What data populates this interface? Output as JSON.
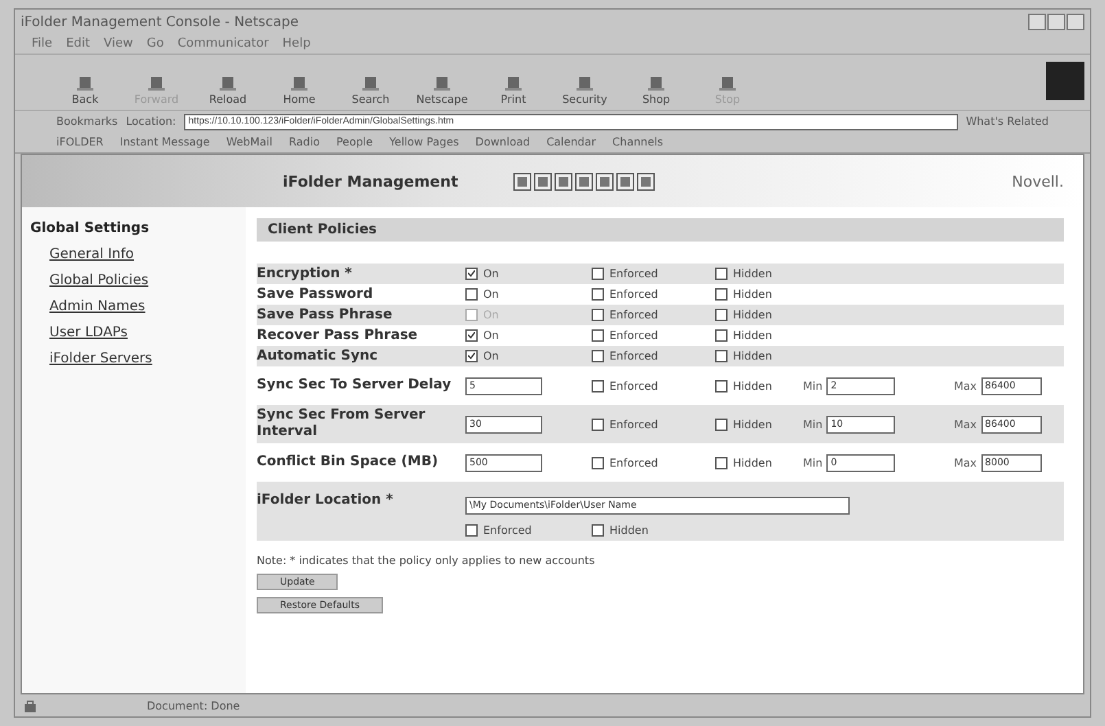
{
  "window": {
    "title": "iFolder Management Console - Netscape"
  },
  "menu": [
    "File",
    "Edit",
    "View",
    "Go",
    "Communicator",
    "Help"
  ],
  "toolbar": [
    {
      "label": "Back",
      "disabled": false
    },
    {
      "label": "Forward",
      "disabled": true
    },
    {
      "label": "Reload",
      "disabled": false
    },
    {
      "label": "Home",
      "disabled": false
    },
    {
      "label": "Search",
      "disabled": false
    },
    {
      "label": "Netscape",
      "disabled": false
    },
    {
      "label": "Print",
      "disabled": false
    },
    {
      "label": "Security",
      "disabled": false
    },
    {
      "label": "Shop",
      "disabled": false
    },
    {
      "label": "Stop",
      "disabled": true
    }
  ],
  "location_bar": {
    "bookmarks": "Bookmarks",
    "label": "Location:",
    "value": "https://10.10.100.123/iFolder/iFolderAdmin/GlobalSettings.htm",
    "related": "What's Related"
  },
  "personal_bar": [
    "iFOLDER",
    "Instant Message",
    "WebMail",
    "Radio",
    "People",
    "Yellow Pages",
    "Download",
    "Calendar",
    "Channels"
  ],
  "header": {
    "title": "iFolder Management",
    "brand": "Novell."
  },
  "sidebar": {
    "title": "Global Settings",
    "items": [
      {
        "label": "General Info"
      },
      {
        "label": "Global Policies"
      },
      {
        "label": "Admin Names"
      },
      {
        "label": "User LDAPs"
      },
      {
        "label": "iFolder Servers"
      }
    ]
  },
  "section": {
    "title": "Client Policies"
  },
  "policies": [
    {
      "kind": "toggle",
      "label": "Encryption *",
      "on": {
        "label": "On",
        "checked": true,
        "disabled": false
      },
      "enforced": {
        "label": "Enforced",
        "checked": false
      },
      "hidden": {
        "label": "Hidden",
        "checked": false
      }
    },
    {
      "kind": "toggle",
      "label": "Save Password",
      "on": {
        "label": "On",
        "checked": false,
        "disabled": false
      },
      "enforced": {
        "label": "Enforced",
        "checked": false
      },
      "hidden": {
        "label": "Hidden",
        "checked": false
      }
    },
    {
      "kind": "toggle",
      "label": "Save Pass Phrase",
      "on": {
        "label": "On",
        "checked": false,
        "disabled": true
      },
      "enforced": {
        "label": "Enforced",
        "checked": false
      },
      "hidden": {
        "label": "Hidden",
        "checked": false
      }
    },
    {
      "kind": "toggle",
      "label": "Recover Pass Phrase",
      "on": {
        "label": "On",
        "checked": true,
        "disabled": false
      },
      "enforced": {
        "label": "Enforced",
        "checked": false
      },
      "hidden": {
        "label": "Hidden",
        "checked": false
      }
    },
    {
      "kind": "toggle",
      "label": "Automatic Sync",
      "on": {
        "label": "On",
        "checked": true,
        "disabled": false
      },
      "enforced": {
        "label": "Enforced",
        "checked": false
      },
      "hidden": {
        "label": "Hidden",
        "checked": false
      }
    },
    {
      "kind": "range",
      "label": "Sync Sec To Server Delay",
      "value": "5",
      "enforced": {
        "label": "Enforced",
        "checked": false
      },
      "hidden": {
        "label": "Hidden",
        "checked": false
      },
      "min_label": "Min",
      "min": "2",
      "max_label": "Max",
      "max": "86400"
    },
    {
      "kind": "range",
      "label": "Sync Sec From Server Interval",
      "value": "30",
      "enforced": {
        "label": "Enforced",
        "checked": false
      },
      "hidden": {
        "label": "Hidden",
        "checked": false
      },
      "min_label": "Min",
      "min": "10",
      "max_label": "Max",
      "max": "86400"
    },
    {
      "kind": "range",
      "label": "Conflict Bin Space (MB)",
      "value": "500",
      "enforced": {
        "label": "Enforced",
        "checked": false
      },
      "hidden": {
        "label": "Hidden",
        "checked": false
      },
      "min_label": "Min",
      "min": "0",
      "max_label": "Max",
      "max": "8000"
    },
    {
      "kind": "location",
      "label": "iFolder Location *",
      "value": "\\My Documents\\iFolder\\User Name",
      "enforced": {
        "label": "Enforced",
        "checked": false
      },
      "hidden": {
        "label": "Hidden",
        "checked": false
      }
    }
  ],
  "note": "Note: * indicates that the policy only applies to new accounts",
  "buttons": [
    "Update",
    "Restore Defaults"
  ],
  "status_bar": {
    "text": "Document: Done"
  }
}
